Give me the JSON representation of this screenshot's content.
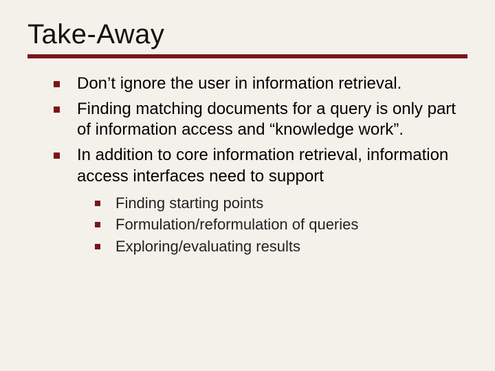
{
  "colors": {
    "accent": "#7a151b",
    "background": "#f4f1ea"
  },
  "title": "Take-Away",
  "bullets": [
    {
      "text": "Don’t ignore the user in information retrieval."
    },
    {
      "text": "Finding matching documents for a query is only part of information access and “knowledge work”."
    },
    {
      "text": "In addition to core information retrieval, information access interfaces need to support",
      "sub": [
        "Finding starting points",
        "Formulation/reformulation of queries",
        "Exploring/evaluating results"
      ]
    }
  ]
}
